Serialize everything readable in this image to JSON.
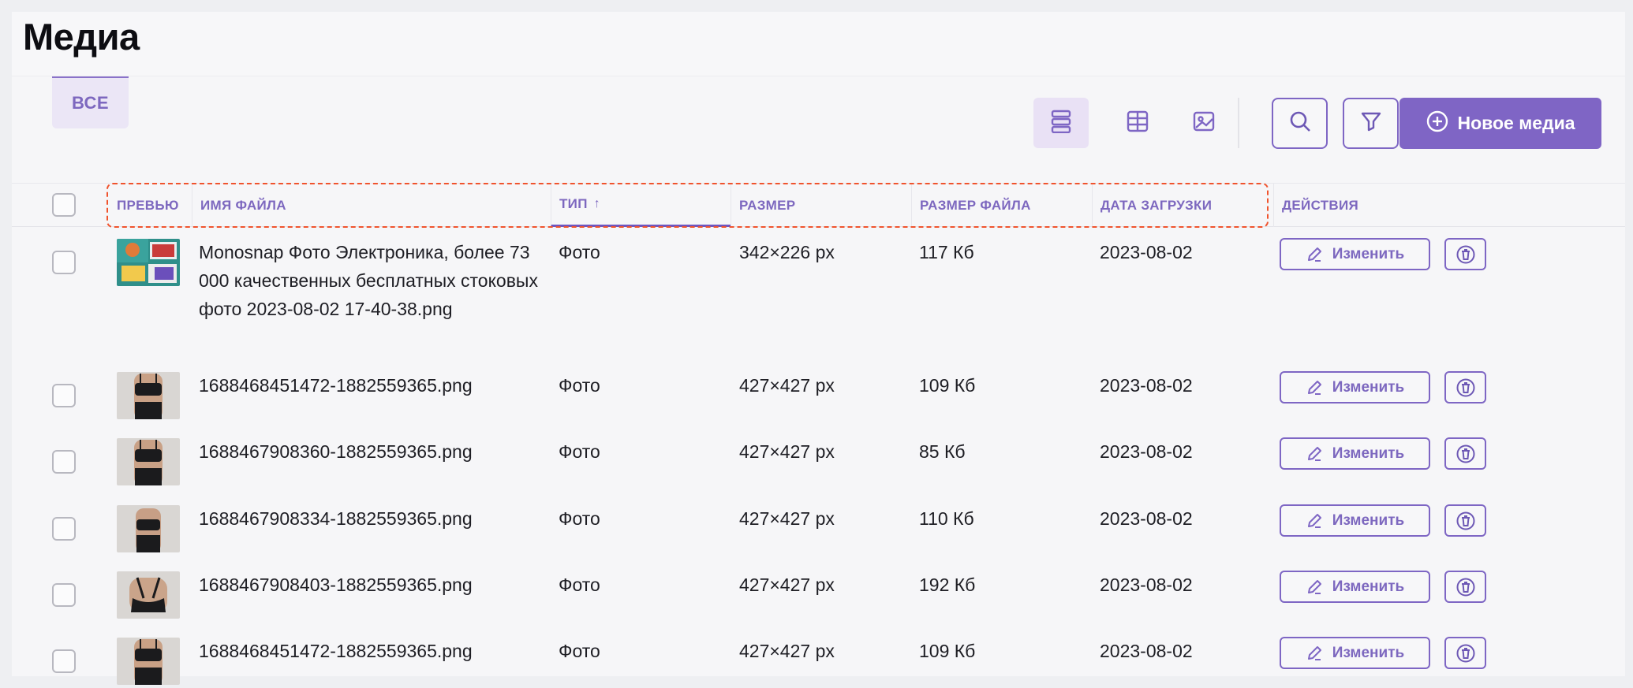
{
  "page": {
    "title": "Медиа"
  },
  "tabs": [
    {
      "label": "ВСЕ",
      "active": true
    }
  ],
  "toolbar": {
    "views": [
      {
        "icon": "list-view-icon",
        "active": true
      },
      {
        "icon": "grid-view-icon",
        "active": false
      },
      {
        "icon": "image-view-icon",
        "active": false
      }
    ],
    "search_icon": "search-icon",
    "filter_icon": "filter-icon",
    "new_media_label": "Новое медиа",
    "accent_color": "#7f65c5"
  },
  "table": {
    "columns": {
      "preview": "ПРЕВЬЮ",
      "filename": "ИМЯ ФАЙЛА",
      "type": "ТИП",
      "type_sort": "↑",
      "dimensions": "РАЗМЕР",
      "filesize": "РАЗМЕР ФАЙЛА",
      "date": "ДАТА ЗАГРУЗКИ",
      "actions": "ДЕЙСТВИЯ"
    },
    "rows": [
      {
        "name": "Monosnap Фото Электроника, более 73 000 качественных бесплатных стоковых фото 2023-08-02 17-40-38.png",
        "type": "Фото",
        "dims": "342×226 px",
        "size": "117 Кб",
        "date": "2023-08-02",
        "edit": "Изменить",
        "thumb": "electronics"
      },
      {
        "name": "1688468451472-1882559365.png",
        "type": "Фото",
        "dims": "427×427 px",
        "size": "109 Кб",
        "date": "2023-08-02",
        "edit": "Изменить",
        "thumb": "front"
      },
      {
        "name": "1688467908360-1882559365.png",
        "type": "Фото",
        "dims": "427×427 px",
        "size": "85 Кб",
        "date": "2023-08-02",
        "edit": "Изменить",
        "thumb": "front"
      },
      {
        "name": "1688467908334-1882559365.png",
        "type": "Фото",
        "dims": "427×427 px",
        "size": "110 Кб",
        "date": "2023-08-02",
        "edit": "Изменить",
        "thumb": "side"
      },
      {
        "name": "1688467908403-1882559365.png",
        "type": "Фото",
        "dims": "427×427 px",
        "size": "192 Кб",
        "date": "2023-08-02",
        "edit": "Изменить",
        "thumb": "back"
      },
      {
        "name": "1688468451472-1882559365.png",
        "type": "Фото",
        "dims": "427×427 px",
        "size": "109 Кб",
        "date": "2023-08-02",
        "edit": "Изменить",
        "thumb": "front"
      }
    ]
  }
}
